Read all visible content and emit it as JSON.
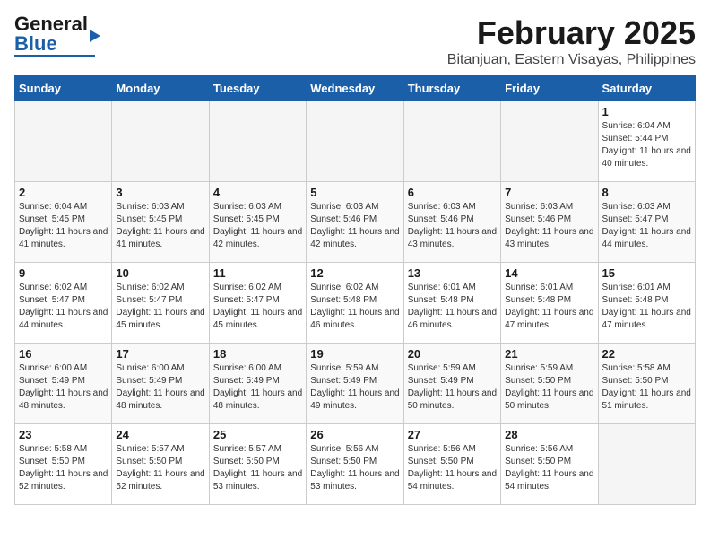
{
  "header": {
    "logo_general": "General",
    "logo_blue": "Blue",
    "title": "February 2025",
    "subtitle": "Bitanjuan, Eastern Visayas, Philippines"
  },
  "weekdays": [
    "Sunday",
    "Monday",
    "Tuesday",
    "Wednesday",
    "Thursday",
    "Friday",
    "Saturday"
  ],
  "weeks": [
    {
      "days": [
        {
          "num": "",
          "info": ""
        },
        {
          "num": "",
          "info": ""
        },
        {
          "num": "",
          "info": ""
        },
        {
          "num": "",
          "info": ""
        },
        {
          "num": "",
          "info": ""
        },
        {
          "num": "",
          "info": ""
        },
        {
          "num": "1",
          "info": "Sunrise: 6:04 AM\nSunset: 5:44 PM\nDaylight: 11 hours and 40 minutes."
        }
      ]
    },
    {
      "days": [
        {
          "num": "2",
          "info": "Sunrise: 6:04 AM\nSunset: 5:45 PM\nDaylight: 11 hours and 41 minutes."
        },
        {
          "num": "3",
          "info": "Sunrise: 6:03 AM\nSunset: 5:45 PM\nDaylight: 11 hours and 41 minutes."
        },
        {
          "num": "4",
          "info": "Sunrise: 6:03 AM\nSunset: 5:45 PM\nDaylight: 11 hours and 42 minutes."
        },
        {
          "num": "5",
          "info": "Sunrise: 6:03 AM\nSunset: 5:46 PM\nDaylight: 11 hours and 42 minutes."
        },
        {
          "num": "6",
          "info": "Sunrise: 6:03 AM\nSunset: 5:46 PM\nDaylight: 11 hours and 43 minutes."
        },
        {
          "num": "7",
          "info": "Sunrise: 6:03 AM\nSunset: 5:46 PM\nDaylight: 11 hours and 43 minutes."
        },
        {
          "num": "8",
          "info": "Sunrise: 6:03 AM\nSunset: 5:47 PM\nDaylight: 11 hours and 44 minutes."
        }
      ]
    },
    {
      "days": [
        {
          "num": "9",
          "info": "Sunrise: 6:02 AM\nSunset: 5:47 PM\nDaylight: 11 hours and 44 minutes."
        },
        {
          "num": "10",
          "info": "Sunrise: 6:02 AM\nSunset: 5:47 PM\nDaylight: 11 hours and 45 minutes."
        },
        {
          "num": "11",
          "info": "Sunrise: 6:02 AM\nSunset: 5:47 PM\nDaylight: 11 hours and 45 minutes."
        },
        {
          "num": "12",
          "info": "Sunrise: 6:02 AM\nSunset: 5:48 PM\nDaylight: 11 hours and 46 minutes."
        },
        {
          "num": "13",
          "info": "Sunrise: 6:01 AM\nSunset: 5:48 PM\nDaylight: 11 hours and 46 minutes."
        },
        {
          "num": "14",
          "info": "Sunrise: 6:01 AM\nSunset: 5:48 PM\nDaylight: 11 hours and 47 minutes."
        },
        {
          "num": "15",
          "info": "Sunrise: 6:01 AM\nSunset: 5:48 PM\nDaylight: 11 hours and 47 minutes."
        }
      ]
    },
    {
      "days": [
        {
          "num": "16",
          "info": "Sunrise: 6:00 AM\nSunset: 5:49 PM\nDaylight: 11 hours and 48 minutes."
        },
        {
          "num": "17",
          "info": "Sunrise: 6:00 AM\nSunset: 5:49 PM\nDaylight: 11 hours and 48 minutes."
        },
        {
          "num": "18",
          "info": "Sunrise: 6:00 AM\nSunset: 5:49 PM\nDaylight: 11 hours and 48 minutes."
        },
        {
          "num": "19",
          "info": "Sunrise: 5:59 AM\nSunset: 5:49 PM\nDaylight: 11 hours and 49 minutes."
        },
        {
          "num": "20",
          "info": "Sunrise: 5:59 AM\nSunset: 5:49 PM\nDaylight: 11 hours and 50 minutes."
        },
        {
          "num": "21",
          "info": "Sunrise: 5:59 AM\nSunset: 5:50 PM\nDaylight: 11 hours and 50 minutes."
        },
        {
          "num": "22",
          "info": "Sunrise: 5:58 AM\nSunset: 5:50 PM\nDaylight: 11 hours and 51 minutes."
        }
      ]
    },
    {
      "days": [
        {
          "num": "23",
          "info": "Sunrise: 5:58 AM\nSunset: 5:50 PM\nDaylight: 11 hours and 52 minutes."
        },
        {
          "num": "24",
          "info": "Sunrise: 5:57 AM\nSunset: 5:50 PM\nDaylight: 11 hours and 52 minutes."
        },
        {
          "num": "25",
          "info": "Sunrise: 5:57 AM\nSunset: 5:50 PM\nDaylight: 11 hours and 53 minutes."
        },
        {
          "num": "26",
          "info": "Sunrise: 5:56 AM\nSunset: 5:50 PM\nDaylight: 11 hours and 53 minutes."
        },
        {
          "num": "27",
          "info": "Sunrise: 5:56 AM\nSunset: 5:50 PM\nDaylight: 11 hours and 54 minutes."
        },
        {
          "num": "28",
          "info": "Sunrise: 5:56 AM\nSunset: 5:50 PM\nDaylight: 11 hours and 54 minutes."
        },
        {
          "num": "",
          "info": ""
        }
      ]
    }
  ]
}
